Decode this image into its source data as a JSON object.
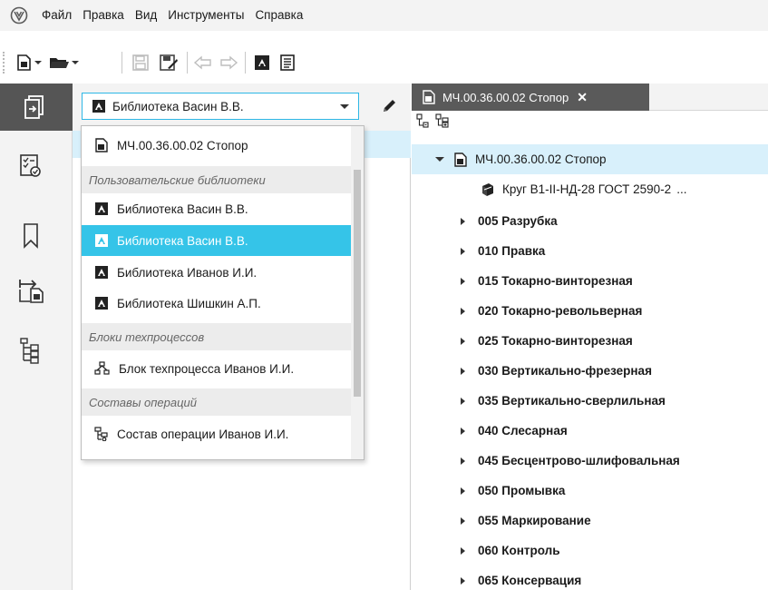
{
  "menu": {
    "logo": "app-logo-icon",
    "items": [
      "Файл",
      "Правка",
      "Вид",
      "Инструменты",
      "Справка"
    ]
  },
  "toolbar": {
    "buttons": [
      "new-document-icon",
      "open-folder-icon",
      "save-icon",
      "save-as-icon",
      "undo-icon",
      "redo-icon",
      "library-icon",
      "catalog-icon"
    ]
  },
  "rail": {
    "buttons": [
      "documents-icon",
      "checklist-icon",
      "bookmark-icon",
      "export-icon",
      "structure-icon"
    ]
  },
  "library_selector": {
    "value": "Библиотека Васин В.В.",
    "edit_icon": "pencil-icon"
  },
  "dropdown": {
    "top_item": "МЧ.00.36.00.02 Стопор",
    "groups": [
      {
        "title": "Пользовательские библиотеки",
        "items": [
          {
            "label": "Библиотека Васин В.В.",
            "selected": false
          },
          {
            "label": "Библиотека Васин В.В.",
            "selected": true
          },
          {
            "label": "Библиотека Иванов И.И.",
            "selected": false
          },
          {
            "label": "Библиотека Шишкин А.П.",
            "selected": false
          }
        ]
      },
      {
        "title": "Блоки техпроцессов",
        "items": [
          {
            "label": "Блок техпроцесса Иванов И.И.",
            "selected": false
          }
        ]
      },
      {
        "title": "Составы операций",
        "items": [
          {
            "label": "Состав операции Иванов И.И.",
            "selected": false
          }
        ]
      }
    ]
  },
  "document_tab": {
    "title": "МЧ.00.36.00.02 Стопор",
    "close": "✕"
  },
  "tree": {
    "root": "МЧ.00.36.00.02 Стопор",
    "material": "Круг В1-II-НД-28 ГОСТ 2590-2",
    "material_more": "...",
    "operations": [
      "005 Разрубка",
      "010 Правка",
      "015 Токарно-винторезная",
      "020 Токарно-револьверная",
      "025 Токарно-винторезная",
      "030 Вертикально-фрезерная",
      "035 Вертикально-сверлильная",
      "040 Слесарная",
      "045 Бесцентрово-шлифовальная",
      "050 Промывка",
      "055 Маркирование",
      "060 Контроль",
      "065 Консервация"
    ]
  },
  "colors": {
    "accent": "#35c4e8",
    "highlight": "#d8f0fb",
    "active_dark": "#555555"
  }
}
